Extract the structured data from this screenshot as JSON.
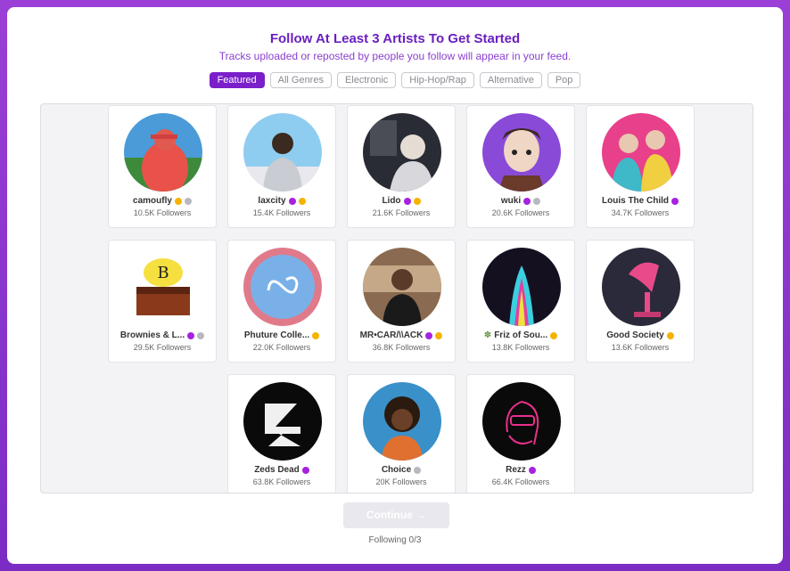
{
  "header": {
    "title": "Follow At Least 3 Artists To Get Started",
    "subtitle": "Tracks uploaded or reposted by people you follow will appear in your feed."
  },
  "tabs": [
    {
      "label": "Featured",
      "active": true
    },
    {
      "label": "All Genres",
      "active": false
    },
    {
      "label": "Electronic",
      "active": false
    },
    {
      "label": "Hip-Hop/Rap",
      "active": false
    },
    {
      "label": "Alternative",
      "active": false
    },
    {
      "label": "Pop",
      "active": false
    }
  ],
  "artists": [
    {
      "name": "camoufly",
      "followers": "10.5K Followers"
    },
    {
      "name": "laxcity",
      "followers": "15.4K Followers"
    },
    {
      "name": "Lido",
      "followers": "21.6K Followers"
    },
    {
      "name": "wuki",
      "followers": "20.6K Followers"
    },
    {
      "name": "Louis The Child",
      "followers": "34.7K Followers"
    },
    {
      "name": "Brownies & L...",
      "followers": "29.5K Followers"
    },
    {
      "name": "Phuture Colle...",
      "followers": "22.0K Followers"
    },
    {
      "name": "MR•CAR/\\\\ACK",
      "followers": "36.8K Followers"
    },
    {
      "name": "Friz of Sou...",
      "followers": "13.8K Followers"
    },
    {
      "name": "Good Society",
      "followers": "13.6K Followers"
    },
    {
      "name": "Zeds Dead",
      "followers": "63.8K Followers"
    },
    {
      "name": "Choice",
      "followers": "20K Followers"
    },
    {
      "name": "Rezz",
      "followers": "66.4K Followers"
    }
  ],
  "footer": {
    "continue_label": "Continue →",
    "following_status": "Following 0/3"
  },
  "colors": {
    "accent": "#7a1fc9",
    "verified_purple": "#a722e0",
    "tier_gold": "#f5b300",
    "tier_grey": "#b8b8bf"
  }
}
